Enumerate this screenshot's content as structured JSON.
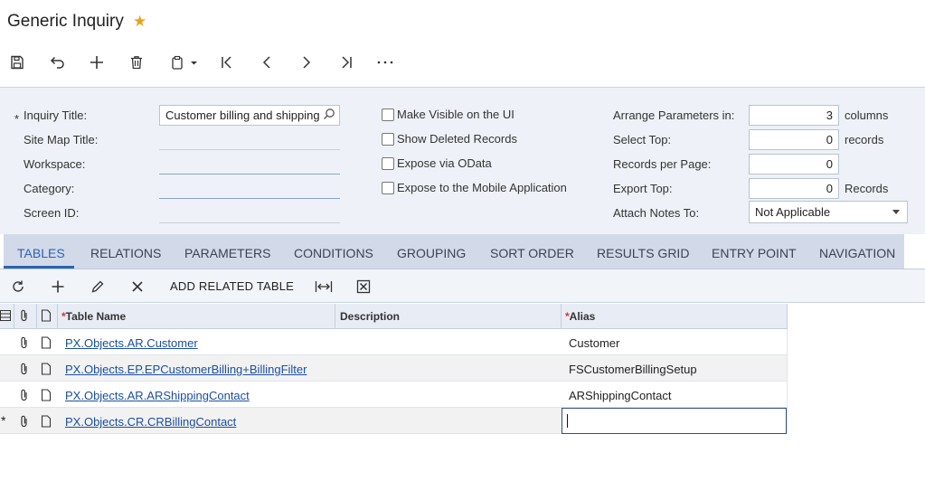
{
  "header": {
    "title": "Generic Inquiry",
    "favorite_icon": "star-icon"
  },
  "toolbar": {
    "buttons": [
      "save-icon",
      "undo-icon",
      "add-icon",
      "delete-icon",
      "copy-paste-icon",
      "first-icon",
      "previous-icon",
      "next-icon",
      "last-icon",
      "more-icon"
    ]
  },
  "form": {
    "inquiry_title_label": "Inquiry Title:",
    "inquiry_title_required": "*",
    "inquiry_title_value": "Customer billing and shipping",
    "site_map_title_label": "Site Map Title:",
    "workspace_label": "Workspace:",
    "category_label": "Category:",
    "screen_id_label": "Screen ID:",
    "checkboxes": [
      {
        "label": "Make Visible on the UI",
        "checked": false
      },
      {
        "label": "Show Deleted Records",
        "checked": false
      },
      {
        "label": "Expose via OData",
        "checked": false
      },
      {
        "label": "Expose to the Mobile Application",
        "checked": false
      }
    ],
    "arrange_label": "Arrange Parameters in:",
    "arrange_value": "3",
    "arrange_unit": "columns",
    "select_top_label": "Select Top:",
    "select_top_value": "0",
    "select_top_unit": "records",
    "records_per_page_label": "Records per Page:",
    "records_per_page_value": "0",
    "export_top_label": "Export Top:",
    "export_top_value": "0",
    "export_top_unit": "Records",
    "attach_notes_label": "Attach Notes To:",
    "attach_notes_value": "Not Applicable"
  },
  "tabs": [
    "TABLES",
    "RELATIONS",
    "PARAMETERS",
    "CONDITIONS",
    "GROUPING",
    "SORT ORDER",
    "RESULTS GRID",
    "ENTRY POINT",
    "NAVIGATION"
  ],
  "active_tab": "TABLES",
  "grid_toolbar": {
    "add_related_table": "ADD RELATED TABLE"
  },
  "grid": {
    "columns": {
      "table_name": "Table Name",
      "description": "Description",
      "alias": "Alias",
      "required_mark": "*"
    },
    "rows": [
      {
        "table_name": "PX.Objects.AR.Customer",
        "description": "",
        "alias": "Customer"
      },
      {
        "table_name": "PX.Objects.EP.EPCustomerBilling+BillingFilter",
        "description": "",
        "alias": "FSCustomerBillingSetup"
      },
      {
        "table_name": "PX.Objects.AR.ARShippingContact",
        "description": "",
        "alias": "ARShippingContact"
      },
      {
        "table_name": "PX.Objects.CR.CRBillingContact",
        "description": "",
        "alias": ""
      }
    ],
    "new_row_marker": "*"
  },
  "colors": {
    "accent": "#2b63b1",
    "form_bg": "#eef2f8",
    "tabs_bg": "#d2d9e9",
    "link": "#1a4fa0",
    "required": "#d9302c",
    "star": "#e8a317"
  }
}
